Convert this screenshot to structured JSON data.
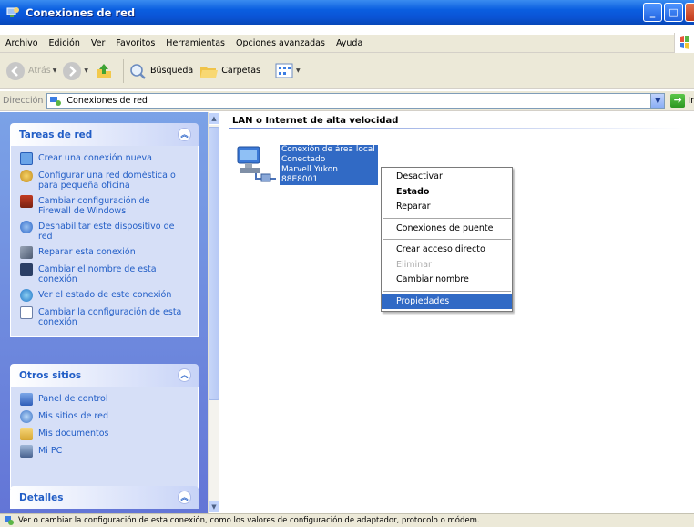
{
  "window": {
    "title": "Conexiones de red"
  },
  "menu": [
    "Archivo",
    "Edición",
    "Ver",
    "Favoritos",
    "Herramientas",
    "Opciones avanzadas",
    "Ayuda"
  ],
  "toolbar": {
    "back": "Atrás",
    "search": "Búsqueda",
    "folders": "Carpetas"
  },
  "address": {
    "label": "Dirección",
    "value": "Conexiones de red",
    "go": "Ir"
  },
  "sidebar": {
    "tasks": {
      "title": "Tareas de red",
      "items": [
        {
          "label": "Crear una conexión nueva",
          "icon": "new-connection-icon"
        },
        {
          "label": "Configurar una red doméstica o para pequeña oficina",
          "icon": "home-network-icon"
        },
        {
          "label": "Cambiar configuración de Firewall de Windows",
          "icon": "firewall-icon"
        },
        {
          "label": "Deshabilitar este dispositivo de red",
          "icon": "disable-device-icon"
        },
        {
          "label": "Reparar esta conexión",
          "icon": "repair-icon"
        },
        {
          "label": "Cambiar el nombre de esta conexión",
          "icon": "rename-icon"
        },
        {
          "label": "Ver el estado de este conexión",
          "icon": "status-icon"
        },
        {
          "label": "Cambiar la configuración de esta conexión",
          "icon": "properties-icon"
        }
      ]
    },
    "other": {
      "title": "Otros sitios",
      "items": [
        {
          "label": "Panel de control",
          "icon": "control-panel-icon"
        },
        {
          "label": "Mis sitios de red",
          "icon": "network-places-icon"
        },
        {
          "label": "Mis documentos",
          "icon": "documents-folder-icon"
        },
        {
          "label": "Mi PC",
          "icon": "my-computer-icon"
        }
      ]
    },
    "details": {
      "title": "Detalles"
    }
  },
  "main": {
    "group_title": "LAN o Internet de alta velocidad",
    "connection": {
      "name": "Conexión de área local",
      "status": "Conectado",
      "device": "Marvell Yukon 88E8001"
    }
  },
  "context_menu": {
    "items": [
      {
        "label": "Desactivar",
        "style": "normal"
      },
      {
        "label": "Estado",
        "style": "bold"
      },
      {
        "label": "Reparar",
        "style": "normal"
      },
      {
        "separator": true
      },
      {
        "label": "Conexiones de puente",
        "style": "normal"
      },
      {
        "separator": true
      },
      {
        "label": "Crear acceso directo",
        "style": "normal"
      },
      {
        "label": "Eliminar",
        "style": "disabled"
      },
      {
        "label": "Cambiar nombre",
        "style": "normal"
      },
      {
        "separator": true
      },
      {
        "label": "Propiedades",
        "style": "selected"
      }
    ]
  },
  "statusbar": {
    "text": "Ver o cambiar la configuración de esta conexión, como los valores de configuración de adaptador, protocolo o módem."
  },
  "colors": {
    "title_blue": "#0a5ee0",
    "selection": "#316ac5",
    "sidebar_gradient_top": "#7ba2e7",
    "link": "#215dc6"
  }
}
